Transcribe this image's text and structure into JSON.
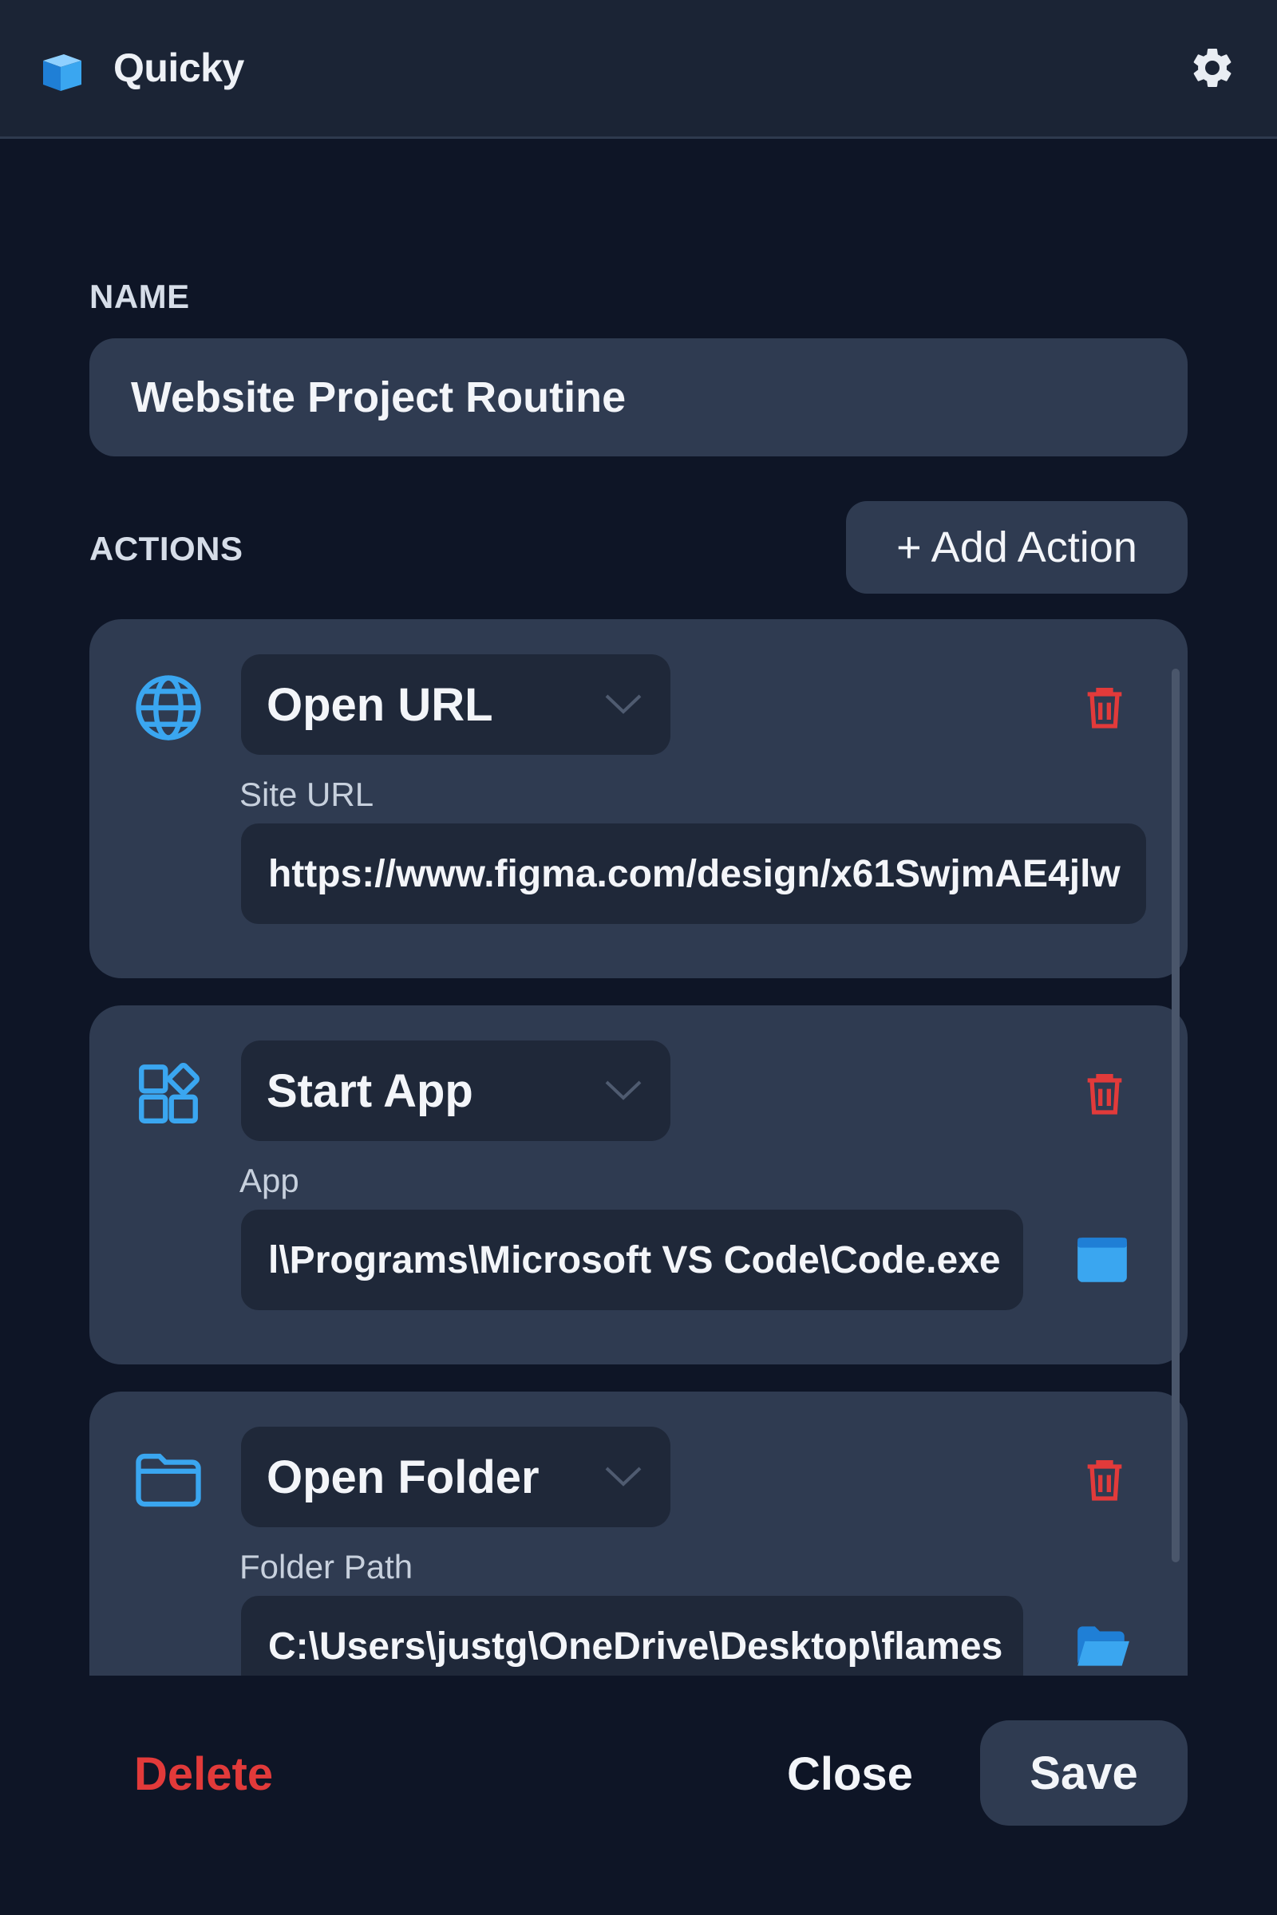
{
  "app": {
    "title": "Quicky"
  },
  "colors": {
    "accent": "#3aa6f0",
    "danger": "#e23a3a",
    "surface": "#2f3b51",
    "background": "#0e1526"
  },
  "icons": {
    "logo": "cube-logo-icon",
    "settings": "gear-icon",
    "delete": "trash-icon",
    "dropdown": "chevron-down-icon"
  },
  "form": {
    "name_label": "NAME",
    "name_value": "Website Project Routine",
    "actions_label": "ACTIONS",
    "add_action_label": "+ Add Action"
  },
  "actions": [
    {
      "icon": "globe-icon",
      "type": "Open URL",
      "field_label": "Site URL",
      "field_value": "https://www.figma.com/design/x61SwjmAE4jlw"
    },
    {
      "icon": "app-grid-icon",
      "type": "Start App",
      "field_label": "App",
      "field_value": "l\\Programs\\Microsoft VS Code\\Code.exe",
      "browse_icon": "window-icon"
    },
    {
      "icon": "folder-icon",
      "type": "Open Folder",
      "field_label": "Folder Path",
      "field_value": "C:\\Users\\justg\\OneDrive\\Desktop\\flames",
      "browse_icon": "folder-open-icon"
    }
  ],
  "footer": {
    "delete_label": "Delete",
    "close_label": "Close",
    "save_label": "Save"
  }
}
